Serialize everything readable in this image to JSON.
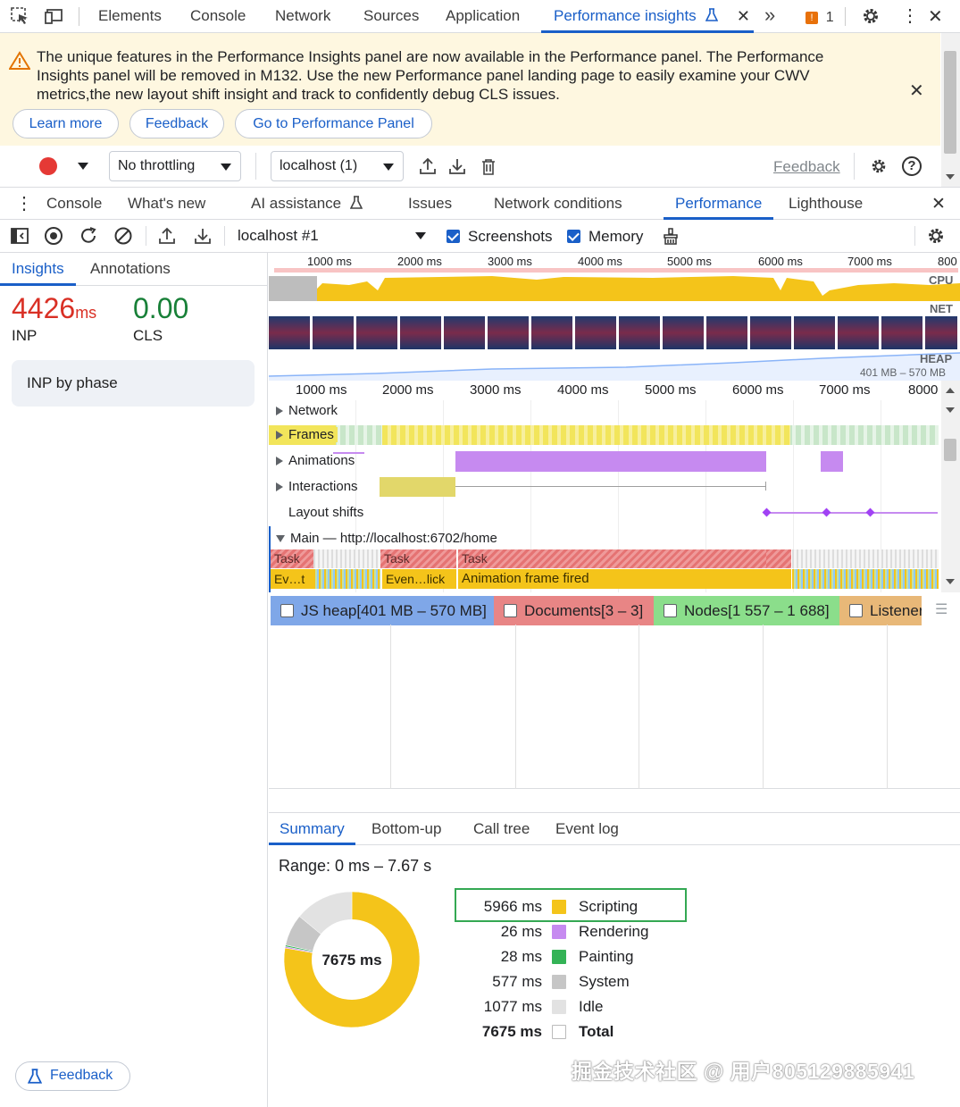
{
  "devtools": {
    "tabs": [
      "Elements",
      "Console",
      "Network",
      "Sources",
      "Application",
      "Performance insights"
    ],
    "issues_count": "1"
  },
  "banner": {
    "message": "The unique features in the Performance Insights panel are now available in the Performance panel. The Performance Insights panel will be removed in M132. Use the new Performance panel landing page to easily examine your CWV metrics,the new layout shift insight and track to confidently debug CLS issues.",
    "learn_more": "Learn more",
    "feedback": "Feedback",
    "go_to": "Go to Performance Panel"
  },
  "controls": {
    "throttling": "No throttling",
    "target": "localhost (1)",
    "feedback_link": "Feedback"
  },
  "drawer": {
    "tabs": [
      "Console",
      "What's new",
      "AI assistance",
      "Issues",
      "Network conditions",
      "Performance",
      "Lighthouse"
    ]
  },
  "perf_toolbar": {
    "recording": "localhost #1",
    "screenshots": "Screenshots",
    "memory": "Memory"
  },
  "left": {
    "tabs": [
      "Insights",
      "Annotations"
    ],
    "inp_value": "4426",
    "inp_unit": "ms",
    "inp_label": "INP",
    "cls_value": "0.00",
    "cls_label": "CLS",
    "inp_by_phase": "INP by phase",
    "feedback": "Feedback"
  },
  "overview": {
    "ticks": [
      "1000 ms",
      "2000 ms",
      "3000 ms",
      "4000 ms",
      "5000 ms",
      "6000 ms",
      "7000 ms",
      "800"
    ],
    "cpu": "CPU",
    "net": "NET",
    "heap": "HEAP",
    "heap_range": "401 MB – 570 MB"
  },
  "timeline": {
    "ticks": [
      "1000 ms",
      "2000 ms",
      "3000 ms",
      "4000 ms",
      "5000 ms",
      "6000 ms",
      "7000 ms",
      "8000"
    ],
    "tracks": {
      "network": "Network",
      "frames": "Frames",
      "animations": "Animations",
      "interactions": "Interactions",
      "layout_shifts": "Layout shifts",
      "main": "Main — http://localhost:6702/home"
    },
    "events": {
      "task1": "Task",
      "task2": "Task",
      "task3": "Task",
      "ev1": "Ev…t",
      "ev2": "Even…lick",
      "anim": "Animation frame fired"
    }
  },
  "counters": {
    "js_heap": "JS heap[401 MB – 570 MB]",
    "documents": "Documents[3 – 3]",
    "nodes": "Nodes[1 557 – 1 688]",
    "listeners": "Listeners"
  },
  "summary": {
    "tabs": [
      "Summary",
      "Bottom-up",
      "Call tree",
      "Event log"
    ],
    "range": "Range: 0 ms – 7.67 s",
    "total_center": "7675 ms",
    "rows": [
      {
        "value": "5966 ms",
        "name": "Scripting",
        "color": "#f4c41a"
      },
      {
        "value": "26 ms",
        "name": "Rendering",
        "color": "#c68af0"
      },
      {
        "value": "28 ms",
        "name": "Painting",
        "color": "#34b356"
      },
      {
        "value": "577 ms",
        "name": "System",
        "color": "#c6c6c6"
      },
      {
        "value": "1077 ms",
        "name": "Idle",
        "color": "#e2e2e2"
      },
      {
        "value": "7675 ms",
        "name": "Total",
        "color": "#ffffff"
      }
    ]
  },
  "watermark": "掘金技术社区 @ 用户805129885941"
}
